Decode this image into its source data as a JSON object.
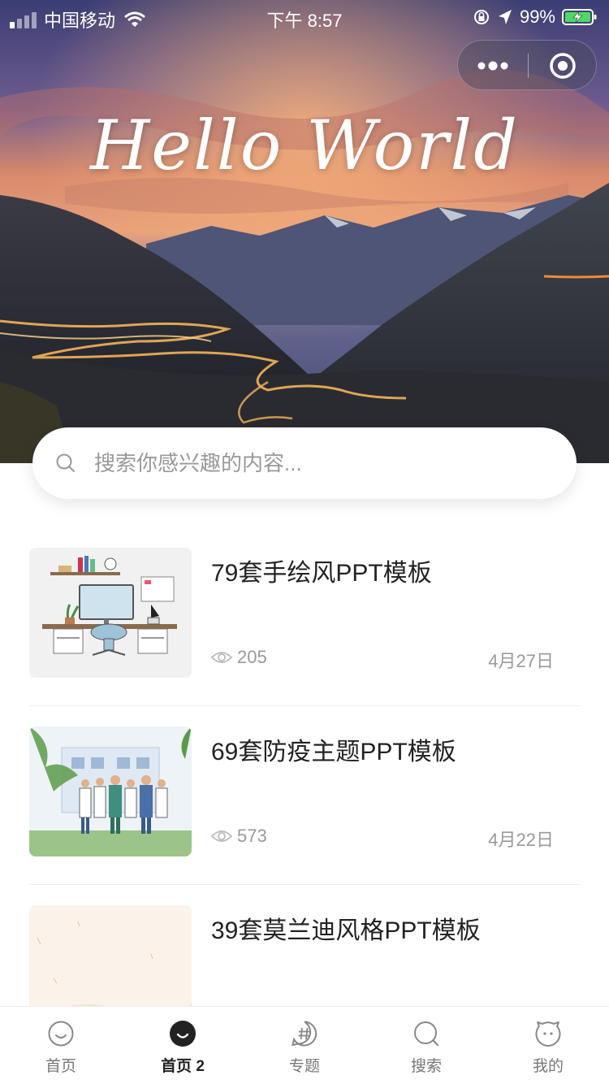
{
  "status_bar": {
    "carrier": "中国移动",
    "time": "下午 8:57",
    "battery": "99%"
  },
  "hero": {
    "title": "Hello World"
  },
  "search": {
    "placeholder": "搜索你感兴趣的内容..."
  },
  "list": {
    "items": [
      {
        "title": "79套手绘风PPT模板",
        "views": "205",
        "date": "4月27日"
      },
      {
        "title": "69套防疫主题PPT模板",
        "views": "573",
        "date": "4月22日"
      },
      {
        "title": "39套莫兰迪风格PPT模板",
        "views": "",
        "date": ""
      }
    ]
  },
  "tabbar": {
    "active_index": 1,
    "tabs": [
      {
        "label": "首页",
        "icon": "smile-icon"
      },
      {
        "label": "首页 2",
        "icon": "smile-filled-icon"
      },
      {
        "label": "专题",
        "icon": "hashtag-icon"
      },
      {
        "label": "搜索",
        "icon": "search-icon"
      },
      {
        "label": "我的",
        "icon": "face-icon"
      }
    ]
  },
  "colors": {
    "accent_text": "#222222",
    "secondary_text": "#999999",
    "sky_top": "#3b3f73",
    "sunset": "#e98a5b",
    "mountain": "#2a2e3a"
  }
}
